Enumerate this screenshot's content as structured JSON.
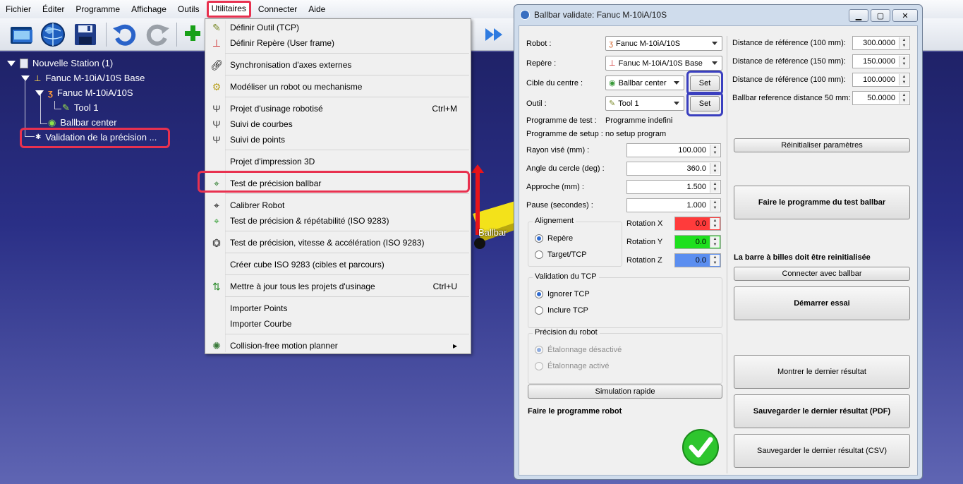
{
  "menubar": {
    "items": [
      "Fichier",
      "Éditer",
      "Programme",
      "Affichage",
      "Outils",
      "Utilitaires",
      "Connecter",
      "Aide"
    ]
  },
  "tree": {
    "station": "Nouvelle Station (1)",
    "base": "Fanuc M-10iA/10S Base",
    "robot": "Fanuc M-10iA/10S",
    "tool": "Tool 1",
    "target": "Ballbar center",
    "program": "Validation de la précision ..."
  },
  "viewport": {
    "label": "Ballbar"
  },
  "dropdown": {
    "items": [
      {
        "label": "Définir Outil (TCP)",
        "shortcut": ""
      },
      {
        "label": "Définir Repère (User frame)",
        "shortcut": ""
      },
      {
        "label": "Synchronisation d'axes externes",
        "shortcut": ""
      },
      {
        "label": "Modéliser un robot ou mechanisme",
        "shortcut": ""
      },
      {
        "label": "Projet d'usinage robotisé",
        "shortcut": "Ctrl+M"
      },
      {
        "label": "Suivi de courbes",
        "shortcut": ""
      },
      {
        "label": "Suivi de points",
        "shortcut": ""
      },
      {
        "label": "Projet d'impression 3D",
        "shortcut": ""
      },
      {
        "label": "Test de précision ballbar",
        "shortcut": ""
      },
      {
        "label": "Calibrer Robot",
        "shortcut": ""
      },
      {
        "label": "Test de précision & répétabilité (ISO 9283)",
        "shortcut": ""
      },
      {
        "label": "Test de précision, vitesse & accélération (ISO 9283)",
        "shortcut": ""
      },
      {
        "label": "Créer cube ISO 9283 (cibles et parcours)",
        "shortcut": ""
      },
      {
        "label": "Mettre à jour tous les projets d'usinage",
        "shortcut": "Ctrl+U"
      },
      {
        "label": "Importer Points",
        "shortcut": ""
      },
      {
        "label": "Importer Courbe",
        "shortcut": ""
      },
      {
        "label": "Collision-free motion planner",
        "shortcut": "▸"
      }
    ]
  },
  "dialog": {
    "title": "Ballbar validate: Fanuc M-10iA/10S",
    "robot_label": "Robot :",
    "robot_value": "Fanuc M-10iA/10S",
    "frame_label": "Repère :",
    "frame_value": "Fanuc M-10iA/10S Base",
    "center_label": "Cible du centre :",
    "center_value": "Ballbar center",
    "tool_label": "Outil :",
    "tool_value": "Tool 1",
    "set_label": "Set",
    "test_prog_label": "Programme de test :",
    "test_prog_value": "Programme indefini",
    "setup_prog_label": "Programme de setup :",
    "setup_prog_value": "no setup program",
    "radius_label": "Rayon visé (mm) :",
    "radius_value": "100.000",
    "angle_label": "Angle du cercle (deg) :",
    "angle_value": "360.0",
    "approach_label": "Approche (mm) :",
    "approach_value": "1.500",
    "pause_label": "Pause (secondes) :",
    "pause_value": "1.000",
    "align_title": "Alignement",
    "align_frame": "Repère",
    "align_target": "Target/TCP",
    "rotx_label": "Rotation X",
    "rotx_value": "0.0",
    "roty_label": "Rotation Y",
    "roty_value": "0.0",
    "rotz_label": "Rotation Z",
    "rotz_value": "0.0",
    "tcp_title": "Validation du TCP",
    "tcp_ignore": "Ignorer TCP",
    "tcp_include": "Inclure TCP",
    "prec_title": "Précision du robot",
    "prec_off": "Étalonnage désactivé",
    "prec_on": "Étalonnage activé",
    "sim_btn": "Simulation rapide",
    "status_text": "Faire le programme robot",
    "ref100_label": "Distance de référence (100 mm):",
    "ref100_value": "300.0000",
    "ref150_label": "Distance de référence (150 mm):",
    "ref150_value": "150.0000",
    "ref100b_label": "Distance de référence (100 mm):",
    "ref100b_value": "100.0000",
    "ref50_label": "Ballbar reference distance 50 mm:",
    "ref50_value": "50.0000",
    "reset_btn": "Réinitialiser paramètres",
    "make_prog_btn": "Faire le programme du test ballbar",
    "reinit_notice": "La barre à billes doit être reinitialisée",
    "connect_btn": "Connecter avec ballbar",
    "start_btn": "Démarrer essai",
    "show_last_btn": "Montrer le dernier résultat",
    "save_pdf_btn": "Sauvegarder le dernier résultat (PDF)",
    "save_csv_btn": "Sauvegarder le dernier résultat (CSV)"
  },
  "colors": {
    "highlight": "#e8314f",
    "set_outline": "#3a3fbf",
    "rotx": "#ff3b3b",
    "roty": "#1ee01e",
    "rotz": "#5b8ef0"
  }
}
